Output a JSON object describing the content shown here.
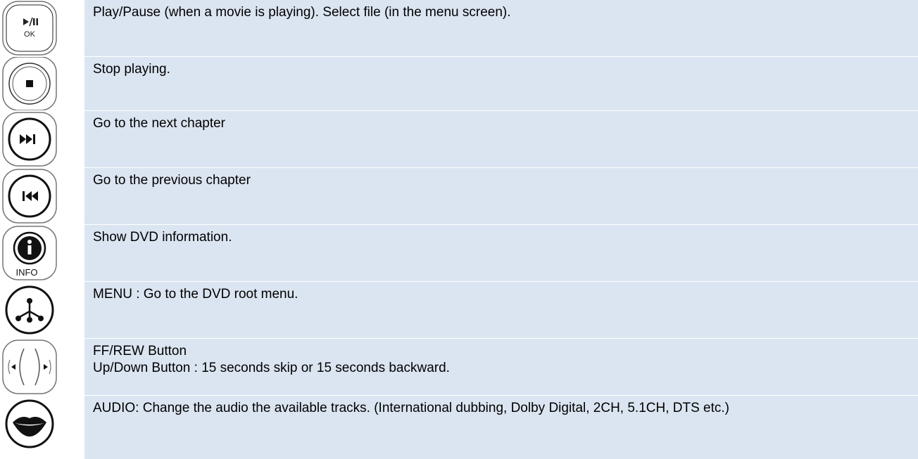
{
  "rows": [
    {
      "icon": "play-pause-ok-icon",
      "icon_label": "OK",
      "lines": [
        "Play/Pause (when a movie is playing). Select file (in the menu screen)."
      ]
    },
    {
      "icon": "stop-icon",
      "lines": [
        "Stop playing."
      ]
    },
    {
      "icon": "next-chapter-icon",
      "lines": [
        "Go to the next chapter"
      ]
    },
    {
      "icon": "previous-chapter-icon",
      "lines": [
        "Go to the previous chapter"
      ]
    },
    {
      "icon": "info-icon",
      "icon_label": "INFO",
      "lines": [
        "Show DVD information."
      ]
    },
    {
      "icon": "menu-icon",
      "lines": [
        "MENU : Go to the DVD root menu."
      ]
    },
    {
      "icon": "ff-rew-icon",
      "lines": [
        "FF/REW Button",
        "Up/Down Button : 15 seconds skip or 15 seconds backward."
      ]
    },
    {
      "icon": "audio-lips-icon",
      "lines": [
        "AUDIO: Change the audio the available tracks. (International dubbing, Dolby Digital, 2CH, 5.1CH, DTS etc.)"
      ]
    }
  ]
}
